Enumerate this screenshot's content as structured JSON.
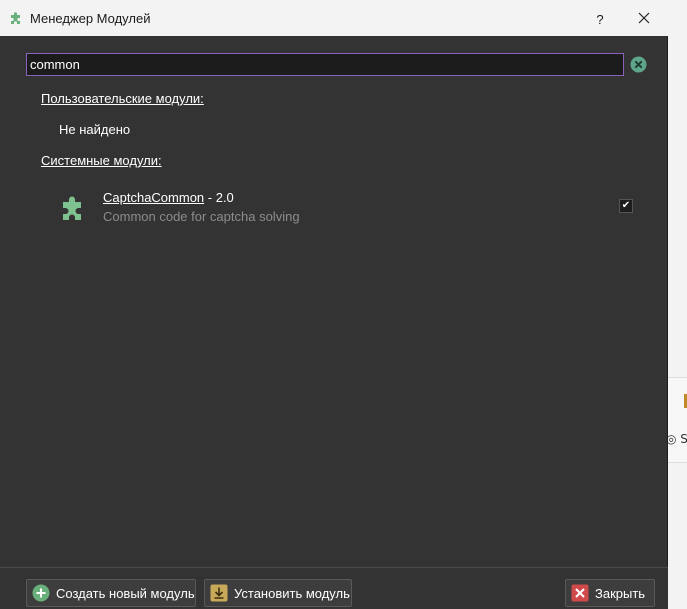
{
  "window": {
    "title": "Менеджер Модулей",
    "help_label": "?"
  },
  "search": {
    "value": "common"
  },
  "sections": {
    "user_header": "Пользовательские модули:",
    "user_empty": "Не найдено",
    "system_header": "Системные модули:"
  },
  "modules": [
    {
      "name": "CaptchaCommon",
      "version": " - 2.0",
      "description": "Common code for captcha solving",
      "enabled": true,
      "check_glyph": "✔"
    }
  ],
  "footer": {
    "create_label": "Создать новый модуль",
    "install_label": "Установить модуль",
    "close_label": "Закрыть"
  },
  "colors": {
    "accent": "#8a62b8",
    "module_icon": "#7fc08f",
    "create_icon": "#6ab07c",
    "install_icon": "#c8a95a",
    "close_icon": "#d04a4a"
  },
  "background_app": {
    "fragment_text": "◎ S"
  }
}
